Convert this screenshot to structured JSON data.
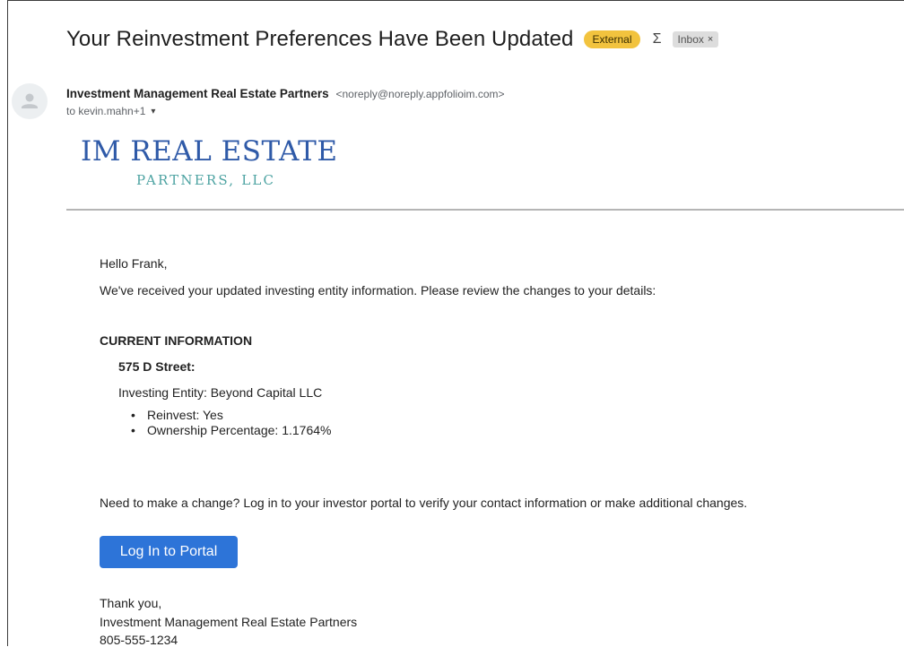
{
  "header": {
    "subject": "Your Reinvestment Preferences Have Been Updated",
    "external_label": "External",
    "importance_glyph": "Σ",
    "inbox_label": "Inbox",
    "inbox_remove": "×"
  },
  "sender": {
    "name": "Investment Management Real Estate Partners",
    "email": "<noreply@noreply.appfolioim.com>",
    "to": "to kevin.mahn+1",
    "caret": "▾"
  },
  "logo": {
    "line1": "IM REAL ESTATE",
    "line2": "PARTNERS, LLC"
  },
  "email_body": {
    "greeting": "Hello Frank,",
    "intro": "We've received your updated investing entity information. Please review the changes to your details:",
    "section_heading": "CURRENT INFORMATION",
    "property": "575 D Street:",
    "entity": "Investing Entity: Beyond Capital LLC",
    "bullets": [
      "Reinvest: Yes",
      "Ownership Percentage: 1.1764%"
    ],
    "change_prompt": "Need to make a change? Log in to your investor portal to verify your contact information or make additional changes.",
    "portal_button": "Log In to Portal",
    "closing": "Thank you,",
    "signature_name": "Investment Management Real Estate Partners",
    "signature_phone": "805-555-1234"
  },
  "colors": {
    "external_badge": "#f2c33e",
    "button": "#2d74d8",
    "logo_blue": "#2f5aa8",
    "logo_teal": "#4da3a2"
  },
  "icons": {
    "avatar": "person-icon",
    "importance": "importance-marker-icon",
    "caret": "chevron-down-icon"
  }
}
